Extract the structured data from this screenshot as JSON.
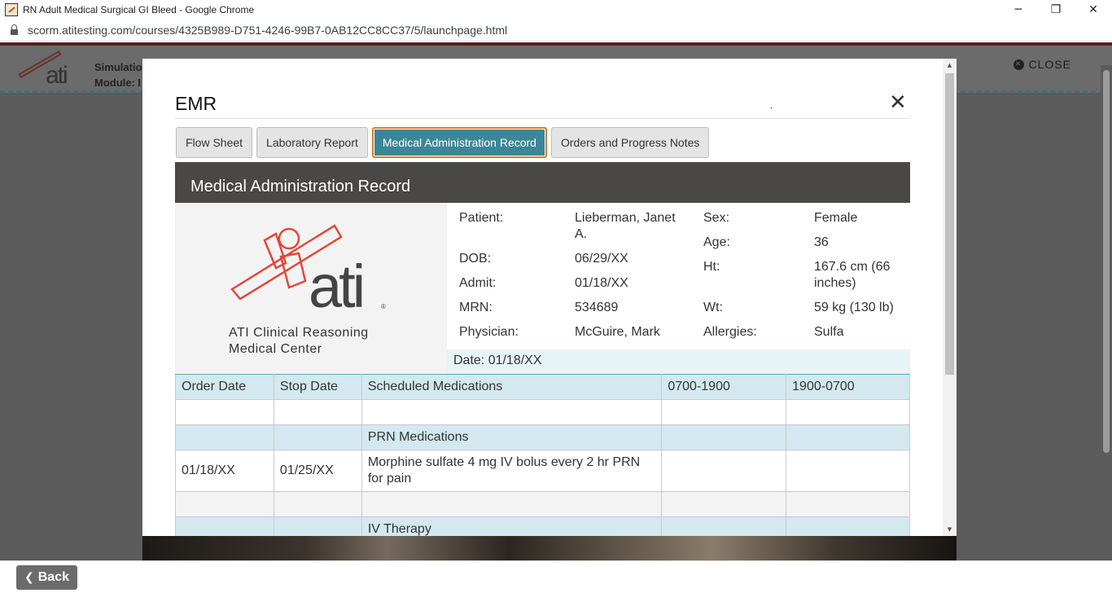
{
  "browser": {
    "window_title": "RN Adult Medical Surgical GI Bleed - Google Chrome",
    "url": "scorm.atitesting.com/courses/4325B989-D751-4246-99B7-0AB12CC8CC37/5/launchpage.html",
    "controls": {
      "minimize": "─",
      "restore": "❐",
      "close": "✕"
    }
  },
  "background_page": {
    "logo_text": "ati",
    "sim_line1": "Simulatio",
    "sim_line2": "Module: I",
    "close_label": "CLOSE",
    "close_icon_glyph": "✕",
    "back_label": "Back",
    "back_icon_glyph": "❮"
  },
  "modal": {
    "title": "EMR",
    "dot": ".",
    "close_glyph": "✕",
    "tabs": [
      {
        "label": "Flow Sheet",
        "active": false
      },
      {
        "label": "Laboratory Report",
        "active": false
      },
      {
        "label": "Medical Administration Record",
        "active": true
      },
      {
        "label": "Orders and Progress Notes",
        "active": false
      }
    ],
    "record_title": "Medical Administration Record",
    "logo": {
      "name_line1": "ATI Clinical Reasoning",
      "name_line2": "Medical Center",
      "brand_color": "#e0483a"
    },
    "patient": {
      "patient_label": "Patient:",
      "patient_value_line1": "Lieberman, Janet",
      "patient_value_line2": "A.",
      "dob_label": "DOB:",
      "dob_value": "06/29/XX",
      "admit_label": "Admit:",
      "admit_value": "01/18/XX",
      "mrn_label": "MRN:",
      "mrn_value": "534689",
      "physician_label": "Physician:",
      "physician_value": "McGuire, Mark",
      "sex_label": "Sex:",
      "sex_value": "Female",
      "age_label": "Age:",
      "age_value": "36",
      "ht_label": "Ht:",
      "ht_value_line1": "167.6 cm (66",
      "ht_value_line2": "inches)",
      "wt_label": "Wt:",
      "wt_value": "59 kg (130 lb)",
      "allergies_label": "Allergies:",
      "allergies_value": "Sulfa"
    },
    "date_line": "Date: 01/18/XX",
    "table": {
      "headers": [
        "Order Date",
        "Stop Date",
        "Scheduled Medications",
        "0700-1900",
        "1900-0700"
      ],
      "prn_section": "PRN Medications",
      "prn_rows": [
        {
          "order_date": "01/18/XX",
          "stop_date": "01/25/XX",
          "med_line1": "Morphine sulfate 4 mg IV bolus every 2 hr PRN",
          "med_line2": "for pain",
          "day": "",
          "night": ""
        }
      ],
      "iv_section": "IV Therapy"
    }
  }
}
